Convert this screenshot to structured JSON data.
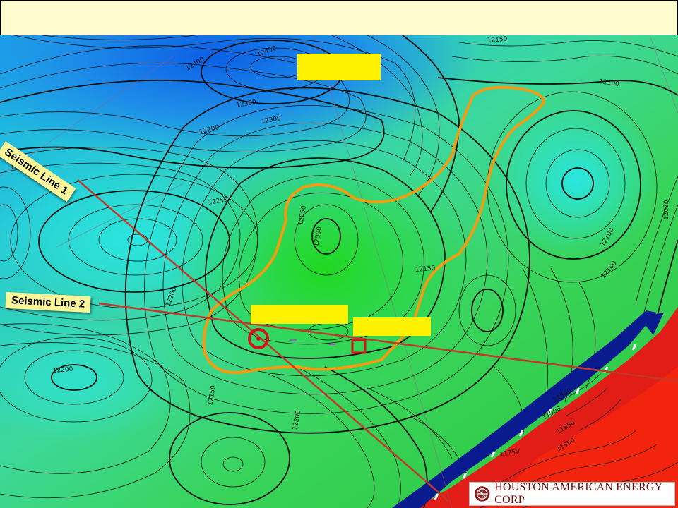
{
  "map": {
    "seismic_lines": [
      "Seismic Line  1",
      "Seismic Line 2"
    ],
    "contour_labels": [
      "12450",
      "12400",
      "12350",
      "12300",
      "12250",
      "12200",
      "12150",
      "12100",
      "12050",
      "12000",
      "11950",
      "11900",
      "11850",
      "11800",
      "11750",
      "12200",
      "12200",
      "12150",
      "12100",
      "12200",
      "12150",
      "12050",
      "12100",
      "12200"
    ],
    "colors": {
      "header_bg": "#fffcd0",
      "highlight_box": "#fff200",
      "outline": "#f39c12",
      "seismic_line": "#c0392b",
      "fault": "#0a1a8f",
      "downthrown": "#e21c16"
    }
  },
  "company": {
    "name": "HOUSTON AMERICAN ENERGY CORP"
  }
}
